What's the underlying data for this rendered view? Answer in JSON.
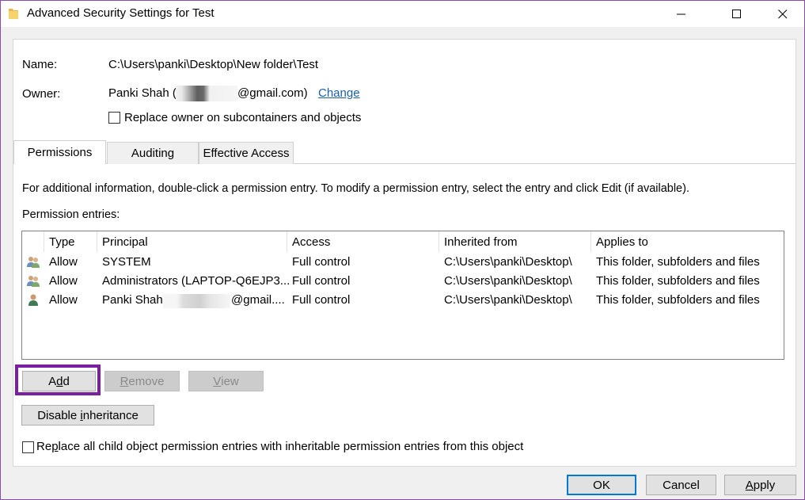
{
  "window": {
    "title": "Advanced Security Settings for Test"
  },
  "name_label": "Name:",
  "name_value": "C:\\Users\\panki\\Desktop\\New folder\\Test",
  "owner_label": "Owner:",
  "owner_prefix": "Panki Shah (",
  "owner_suffix": "@gmail.com)",
  "owner_change": "Change",
  "replace_owner_label": "Replace owner on subcontainers and objects",
  "tabs": [
    {
      "label": "Permissions"
    },
    {
      "label": "Auditing"
    },
    {
      "label": "Effective Access"
    }
  ],
  "info_text": "For additional information, double-click a permission entry. To modify a permission entry, select the entry and click Edit (if available).",
  "entries_label": "Permission entries:",
  "columns": [
    "Type",
    "Principal",
    "Access",
    "Inherited from",
    "Applies to"
  ],
  "rows": [
    {
      "icon": "group-users-icon",
      "type": "Allow",
      "principal": "SYSTEM",
      "access": "Full control",
      "inherited": "C:\\Users\\panki\\Desktop\\",
      "applies": "This folder, subfolders and files"
    },
    {
      "icon": "group-users-icon",
      "type": "Allow",
      "principal": "Administrators (LAPTOP-Q6EJP3...",
      "access": "Full control",
      "inherited": "C:\\Users\\panki\\Desktop\\",
      "applies": "This folder, subfolders and files"
    },
    {
      "icon": "single-user-icon",
      "type": "Allow",
      "principal_prefix": "Panki Shah (",
      "principal_suffix": "@gmail....",
      "access": "Full control",
      "inherited": "C:\\Users\\panki\\Desktop\\",
      "applies": "This folder, subfolders and files"
    }
  ],
  "buttons": {
    "add": {
      "pre": "A",
      "ul": "d",
      "post": "d"
    },
    "remove": {
      "pre": "",
      "ul": "R",
      "post": "emove"
    },
    "view": {
      "pre": "",
      "ul": "V",
      "post": "iew"
    },
    "disable_inheritance": {
      "pre": "Disable ",
      "ul": "i",
      "post": "nheritance"
    },
    "ok": "OK",
    "cancel": "Cancel",
    "apply": {
      "pre": "",
      "ul": "A",
      "post": "pply"
    }
  },
  "replace_child": {
    "pre": "Re",
    "ul": "p",
    "post": "lace all child object permission entries with inheritable permission entries from this object"
  },
  "colors": {
    "highlight": "#7b1fa2",
    "link": "#1b5fa6",
    "focus": "#0078d7"
  }
}
